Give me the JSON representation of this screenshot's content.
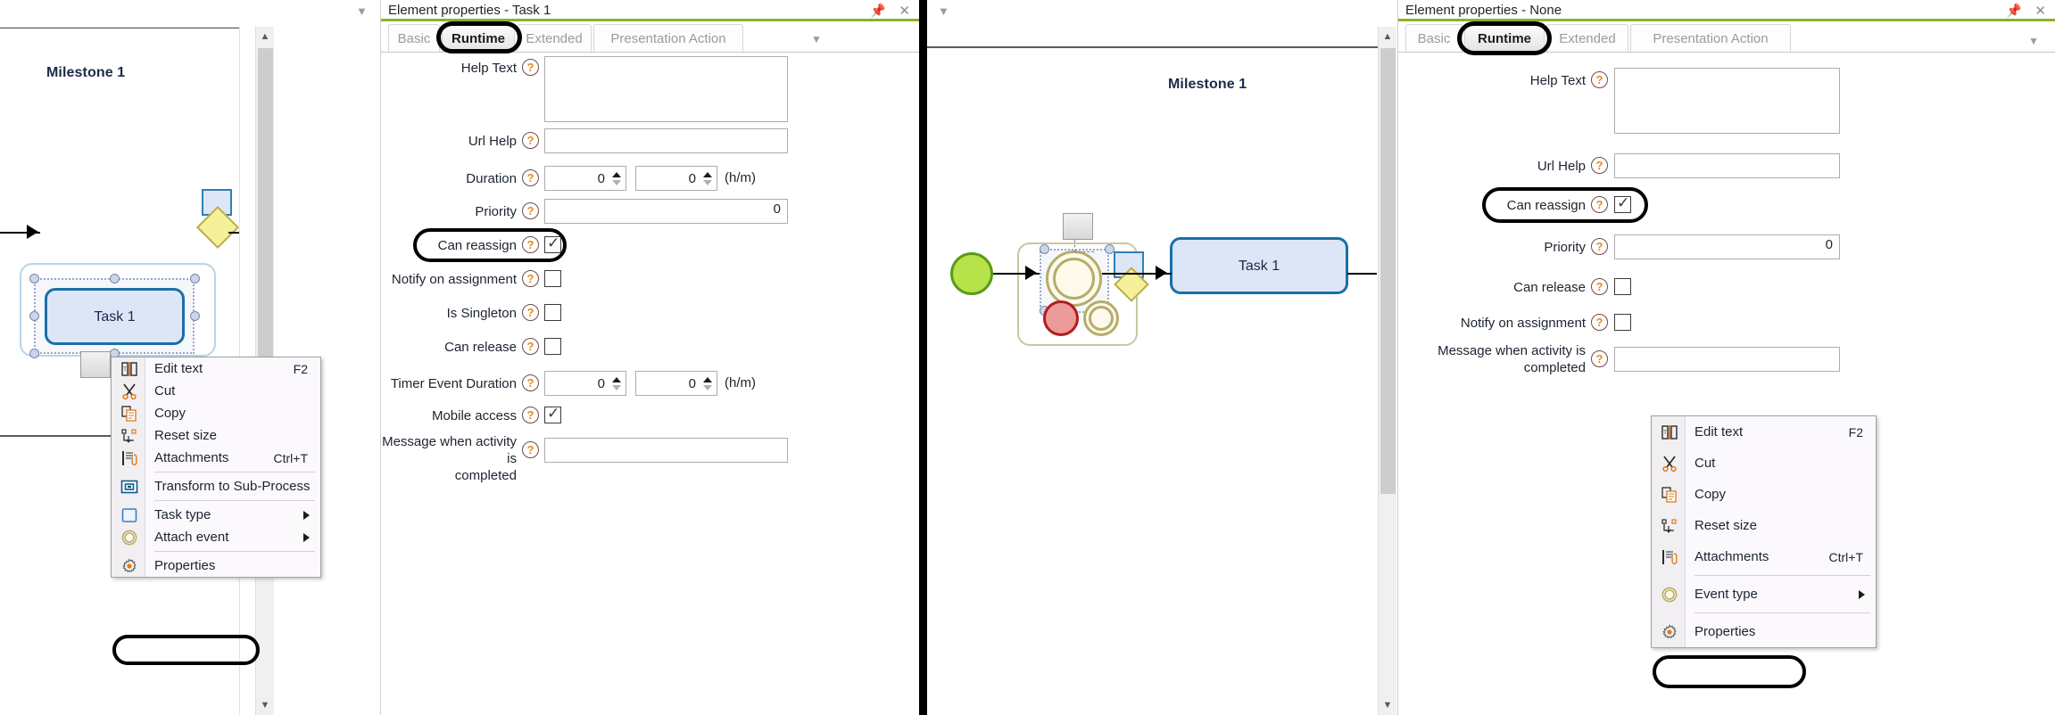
{
  "left": {
    "canvas": {
      "milestone_label": "Milestone 1",
      "task_label": "Task 1"
    },
    "properties": {
      "title": "Element properties - Task 1",
      "pin_icon": "pin-icon",
      "close_icon": "close-icon",
      "tabs": [
        {
          "label": "Basic",
          "active": false
        },
        {
          "label": "Runtime",
          "active": true
        },
        {
          "label": "Extended",
          "active": false
        },
        {
          "label": "Presentation Action",
          "active": false
        }
      ],
      "tabs_overflow_icon": "chevron-down-icon",
      "fields": [
        {
          "label": "Help Text",
          "type": "textarea",
          "value": ""
        },
        {
          "label": "Url Help",
          "type": "text",
          "value": ""
        },
        {
          "label": "Duration",
          "type": "duration",
          "value1": "0",
          "value2": "0",
          "unit": "(h/m)"
        },
        {
          "label": "Priority",
          "type": "text",
          "value": "0"
        },
        {
          "label": "Can reassign",
          "type": "checkbox",
          "checked": true,
          "highlighted": true
        },
        {
          "label": "Notify on assignment",
          "type": "checkbox",
          "checked": false
        },
        {
          "label": "Is Singleton",
          "type": "checkbox",
          "checked": false
        },
        {
          "label": "Can release",
          "type": "checkbox",
          "checked": false
        },
        {
          "label": "Timer Event Duration",
          "type": "duration",
          "value1": "0",
          "value2": "0",
          "unit": "(h/m)"
        },
        {
          "label": "Mobile access",
          "type": "checkbox",
          "checked": true
        },
        {
          "label": "Message when activity is\ncompleted",
          "type": "text",
          "value": ""
        }
      ]
    },
    "context_menu": {
      "items": [
        {
          "label": "Edit text",
          "accel": "F2",
          "icon": "edit-text-icon",
          "submenu": false
        },
        {
          "label": "Cut",
          "accel": "",
          "icon": "cut-icon",
          "submenu": false
        },
        {
          "label": "Copy",
          "accel": "",
          "icon": "copy-icon",
          "submenu": false
        },
        {
          "label": "Reset size",
          "accel": "",
          "icon": "reset-size-icon",
          "submenu": false
        },
        {
          "label": "Attachments",
          "accel": "Ctrl+T",
          "icon": "attachments-icon",
          "submenu": false
        },
        {
          "label": "Transform to Sub-Process",
          "accel": "",
          "icon": "sub-process-icon",
          "submenu": false
        },
        {
          "label": "Task type",
          "accel": "",
          "icon": "task-type-icon",
          "submenu": true
        },
        {
          "label": "Attach event",
          "accel": "",
          "icon": "attach-event-icon",
          "submenu": true
        },
        {
          "label": "Properties",
          "accel": "",
          "icon": "gear-icon",
          "submenu": false,
          "highlighted": true
        }
      ]
    }
  },
  "right": {
    "canvas": {
      "milestone_label": "Milestone 1",
      "task_label": "Task 1"
    },
    "properties": {
      "title": "Element properties - None",
      "pin_icon": "pin-icon",
      "close_icon": "close-icon",
      "tabs": [
        {
          "label": "Basic",
          "active": false
        },
        {
          "label": "Runtime",
          "active": true
        },
        {
          "label": "Extended",
          "active": false
        },
        {
          "label": "Presentation Action",
          "active": false
        }
      ],
      "tabs_overflow_icon": "chevron-down-icon",
      "fields": [
        {
          "label": "Help Text",
          "type": "textarea",
          "value": ""
        },
        {
          "label": "Url Help",
          "type": "text",
          "value": ""
        },
        {
          "label": "Can reassign",
          "type": "checkbox",
          "checked": true,
          "highlighted": true
        },
        {
          "label": "Priority",
          "type": "text",
          "value": "0"
        },
        {
          "label": "Can release",
          "type": "checkbox",
          "checked": false
        },
        {
          "label": "Notify on assignment",
          "type": "checkbox",
          "checked": false
        },
        {
          "label": "Message when activity is\ncompleted",
          "type": "text",
          "value": ""
        }
      ]
    },
    "context_menu": {
      "items": [
        {
          "label": "Edit text",
          "accel": "F2",
          "icon": "edit-text-icon",
          "submenu": false
        },
        {
          "label": "Cut",
          "accel": "",
          "icon": "cut-icon",
          "submenu": false
        },
        {
          "label": "Copy",
          "accel": "",
          "icon": "copy-icon",
          "submenu": false
        },
        {
          "label": "Reset size",
          "accel": "",
          "icon": "reset-size-icon",
          "submenu": false
        },
        {
          "label": "Attachments",
          "accel": "Ctrl+T",
          "icon": "attachments-icon",
          "submenu": false
        },
        {
          "label": "Event type",
          "accel": "",
          "icon": "attach-event-icon",
          "submenu": true
        },
        {
          "label": "Properties",
          "accel": "",
          "icon": "gear-icon",
          "submenu": false,
          "highlighted": true
        }
      ]
    }
  },
  "colors": {
    "accent_green": "#8cb224",
    "task_fill": "#dde6f7",
    "task_border": "#1a6fa8",
    "gateway_fill": "#f6f09a",
    "event_red": "#b21c1c",
    "event_green": "#5a9a19",
    "help_icon": "#e98a22",
    "highlight": "#000000"
  }
}
